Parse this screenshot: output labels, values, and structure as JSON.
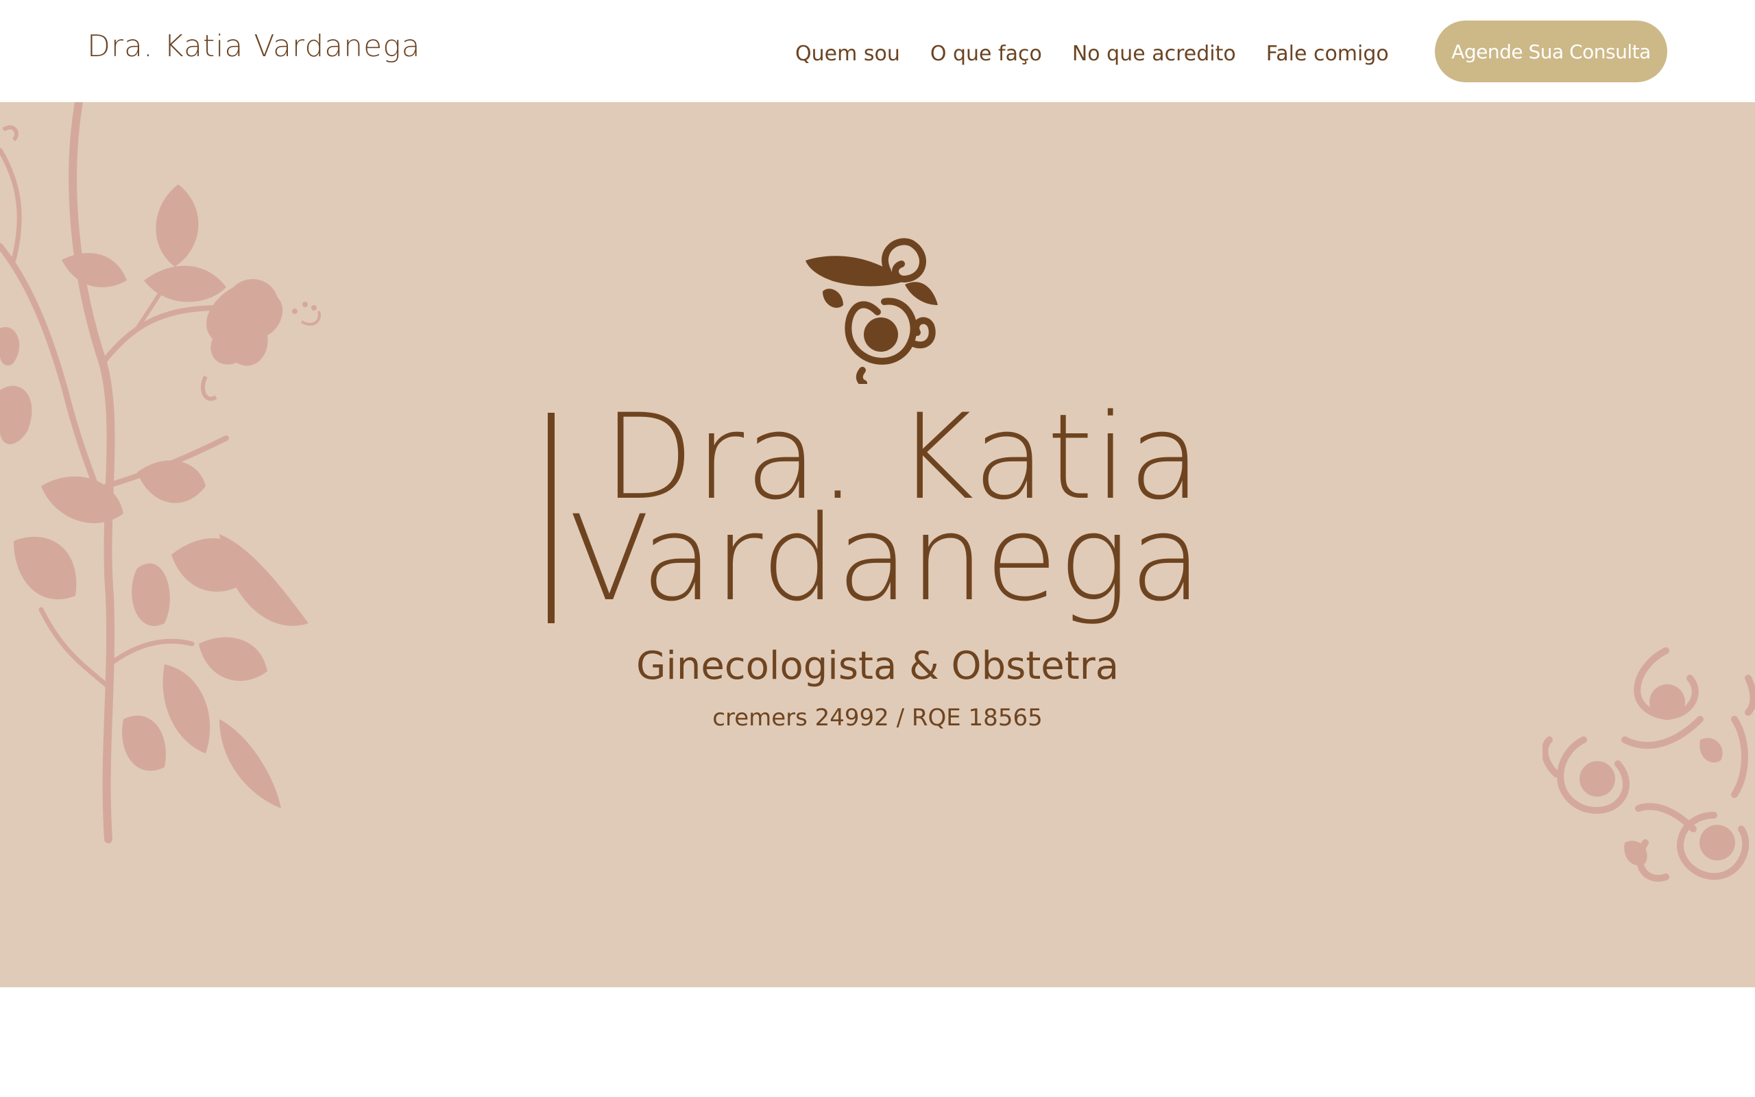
{
  "header": {
    "brand": "Dra. Katia Vardanega",
    "nav": [
      {
        "label": "Quem sou"
      },
      {
        "label": "O que faço"
      },
      {
        "label": "No que acredito"
      },
      {
        "label": "Fale comigo"
      }
    ],
    "cta_label": "Agende Sua Consulta"
  },
  "hero": {
    "name_line1": "Dra. Katia",
    "name_line2": "Vardanega",
    "specialty": "Ginecologista & Obstetra",
    "registration": "cremers 24992 / RQE 18565",
    "emblem_icon": "floral-emblem-icon",
    "decor_left_icon": "floral-branch-icon",
    "decor_right_icon": "floral-ornament-icon"
  },
  "colors": {
    "brand_brown": "#6e4420",
    "hero_background": "#e0cbb8",
    "decor_pink": "#d4a99c",
    "cta_background": "#cdb887",
    "cta_text": "#ffffff"
  }
}
